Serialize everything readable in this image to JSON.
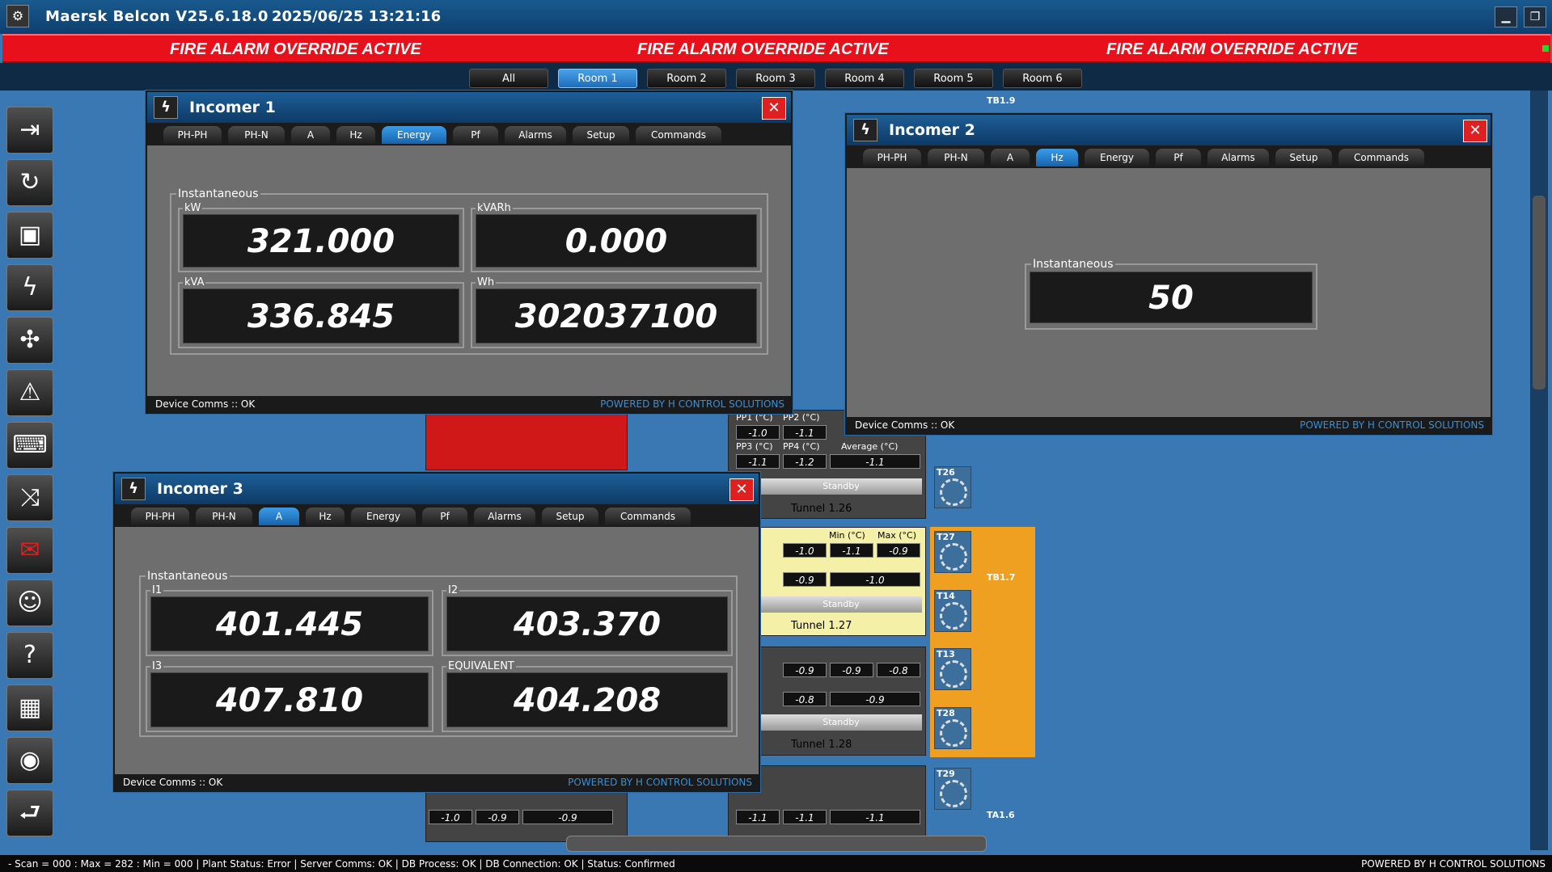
{
  "app": {
    "title": "Maersk Belcon V25.6.18.0",
    "timestamp": "2025/06/25 13:21:16"
  },
  "alarm": {
    "text": "FIRE ALARM OVERRIDE ACTIVE"
  },
  "rooms": [
    "All",
    "Room 1",
    "Room 2",
    "Room 3",
    "Room 4",
    "Room 5",
    "Room 6"
  ],
  "sidebar": [
    "login-icon",
    "refresh-icon",
    "save-icon",
    "power-icon",
    "fan-icon",
    "alarm-icon",
    "keyboard-icon",
    "shuffle-icon",
    "mail-icon",
    "user-settings-icon",
    "help-icon",
    "qr-code-icon",
    "eye-icon",
    "exit-icon"
  ],
  "background": {
    "labels": {
      "tb19": "TB1.9",
      "tb17": "TB1.7",
      "ta16": "TA1.6",
      "t26": "T26",
      "t27": "T27",
      "t14": "T14",
      "t13": "T13",
      "t28": "T28",
      "t29": "T29",
      "tunnel126": "Tunnel 1.26",
      "tunnel127": "Tunnel 1.27",
      "tunnel128": "Tunnel 1.28",
      "tunnel1": "Tunnel 1.",
      "standby": "Standby",
      "pp1": "PP1 (°C)",
      "pp2": "PP2 (°C)",
      "pp3": "PP3 (°C)",
      "pp4": "PP4 (°C)",
      "min": "Min (°C)",
      "max": "Max (°C)",
      "avg": "Average (°C)"
    }
  },
  "incomer1": {
    "title": "Incomer 1",
    "tabs": [
      "PH-PH",
      "PH-N",
      "A",
      "Hz",
      "Energy",
      "Pf",
      "Alarms",
      "Setup",
      "Commands"
    ],
    "active_tab": "Energy",
    "group": "Instantaneous",
    "fields": [
      {
        "label": "kW",
        "value": "321.000"
      },
      {
        "label": "kVARh",
        "value": "0.000"
      },
      {
        "label": "kVA",
        "value": "336.845"
      },
      {
        "label": "Wh",
        "value": "302037100"
      }
    ],
    "status": "Device Comms :: OK",
    "powered": "POWERED BY H CONTROL SOLUTIONS"
  },
  "incomer2": {
    "title": "Incomer 2",
    "tabs": [
      "PH-PH",
      "PH-N",
      "A",
      "Hz",
      "Energy",
      "Pf",
      "Alarms",
      "Setup",
      "Commands"
    ],
    "active_tab": "Hz",
    "group": "Instantaneous",
    "value": "50",
    "status": "Device Comms :: OK",
    "powered": "POWERED BY H CONTROL SOLUTIONS"
  },
  "incomer3": {
    "title": "Incomer 3",
    "tabs": [
      "PH-PH",
      "PH-N",
      "A",
      "Hz",
      "Energy",
      "Pf",
      "Alarms",
      "Setup",
      "Commands"
    ],
    "active_tab": "A",
    "group": "Instantaneous",
    "fields": [
      {
        "label": "I1",
        "value": "401.445"
      },
      {
        "label": "I2",
        "value": "403.370"
      },
      {
        "label": "I3",
        "value": "407.810"
      },
      {
        "label": "EQUIVALENT",
        "value": "404.208"
      }
    ],
    "status": "Device Comms :: OK",
    "powered": "POWERED BY H CONTROL SOLUTIONS"
  },
  "statusbar": {
    "left": "- Scan = 000 : Max = 282 : Min = 000  |  Plant Status: Error  |  Server Comms: OK  |  DB Process: OK  |  DB Connection:  OK  |  Status: Confirmed",
    "right": "POWERED BY H CONTROL SOLUTIONS"
  },
  "colors": {
    "alarm": "#e8101a",
    "accent": "#1e6cb8",
    "background": "#3a78b4"
  }
}
